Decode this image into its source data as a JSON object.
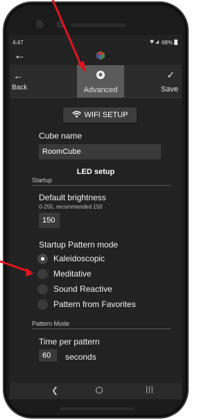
{
  "status_bar": {
    "time": "4:47",
    "battery": "68%",
    "icons": "☷ .∣"
  },
  "app_bar": {
    "back_icon": "back-arrow-icon",
    "logo_icon": "cube-logo-icon"
  },
  "toolbar": {
    "back_label": "Back",
    "advanced_label": "Advanced",
    "save_label": "Save"
  },
  "wifi_button": {
    "label": "WIFI SETUP",
    "icon": "wifi-icon"
  },
  "cube_name": {
    "label": "Cube name",
    "value": "RoomCube"
  },
  "led_setup": {
    "title": "LED setup",
    "startup_section": "Startup",
    "default_brightness": {
      "label": "Default brightness",
      "hint": "0-255, recommended 150",
      "value": "150"
    },
    "startup_pattern_mode": {
      "label": "Startup Pattern mode",
      "options": [
        "Kaleidoscopic",
        "Meditative",
        "Sound Reactive",
        "Pattern from Favorites"
      ],
      "selected": "Kaleidoscopic"
    },
    "pattern_mode_section": "Pattern Mode",
    "time_per_pattern": {
      "label": "Time per pattern",
      "value": "60",
      "unit": "seconds"
    }
  },
  "nav_bar": {
    "back_icon": "nav-back-icon",
    "home_icon": "nav-home-icon",
    "recents_icon": "nav-recents-icon"
  },
  "colors": {
    "background": "#222222",
    "toolbar": "#2b2b2b",
    "advanced_highlight": "#5a5a5a",
    "annotation": "#e0141e"
  }
}
